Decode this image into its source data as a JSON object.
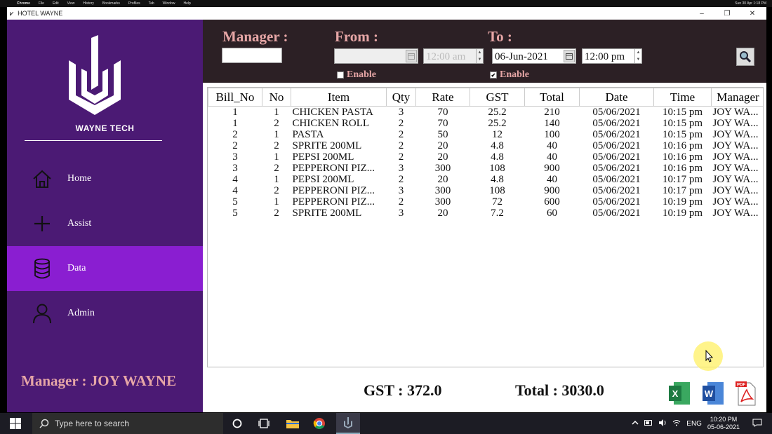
{
  "window": {
    "title": "HOTEL WAYNE"
  },
  "mac_menu": [
    "Chrome",
    "File",
    "Edit",
    "View",
    "History",
    "Bookmarks",
    "Profiles",
    "Tab",
    "Window",
    "Help"
  ],
  "mac_status": "Sun 30 Apr 1:18 PM",
  "sidebar": {
    "brand": "WAYNE TECH",
    "items": [
      {
        "label": "Home",
        "icon": "home-icon"
      },
      {
        "label": "Assist",
        "icon": "plus-icon"
      },
      {
        "label": "Data",
        "icon": "database-icon"
      },
      {
        "label": "Admin",
        "icon": "user-icon"
      }
    ],
    "active": "Data",
    "manager_label": "Manager : JOY WAYNE"
  },
  "filter": {
    "manager_label": "Manager  :",
    "manager_value": "",
    "from_label": "From :",
    "from_date": "",
    "from_time": "12:00 am",
    "from_enable_label": "Enable",
    "from_enabled": false,
    "to_label": "To :",
    "to_date": "06-Jun-2021",
    "to_time": "12:00 pm",
    "to_enable_label": "Enable",
    "to_enabled": true
  },
  "table": {
    "columns": [
      "Bill_No",
      "No",
      "Item",
      "Qty",
      "Rate",
      "GST",
      "Total",
      "Date",
      "Time",
      "Manager"
    ],
    "rows": [
      [
        "1",
        "1",
        "CHICKEN PASTA",
        "3",
        "70",
        "25.2",
        "210",
        "05/06/2021",
        "10:15 pm",
        "JOY WA..."
      ],
      [
        "1",
        "2",
        "CHICKEN ROLL",
        "2",
        "70",
        "25.2",
        "140",
        "05/06/2021",
        "10:15 pm",
        "JOY WA..."
      ],
      [
        "2",
        "1",
        "PASTA",
        "2",
        "50",
        "12",
        "100",
        "05/06/2021",
        "10:15 pm",
        "JOY WA..."
      ],
      [
        "2",
        "2",
        "SPRITE 200ML",
        "2",
        "20",
        "4.8",
        "40",
        "05/06/2021",
        "10:16 pm",
        "JOY WA..."
      ],
      [
        "3",
        "1",
        "PEPSI 200ML",
        "2",
        "20",
        "4.8",
        "40",
        "05/06/2021",
        "10:16 pm",
        "JOY WA..."
      ],
      [
        "3",
        "2",
        "PEPPERONI PIZ...",
        "3",
        "300",
        "108",
        "900",
        "05/06/2021",
        "10:16 pm",
        "JOY WA..."
      ],
      [
        "4",
        "1",
        "PEPSI 200ML",
        "2",
        "20",
        "4.8",
        "40",
        "05/06/2021",
        "10:17 pm",
        "JOY WA..."
      ],
      [
        "4",
        "2",
        "PEPPERONI PIZ...",
        "3",
        "300",
        "108",
        "900",
        "05/06/2021",
        "10:17 pm",
        "JOY WA..."
      ],
      [
        "5",
        "1",
        "PEPPERONI PIZ...",
        "2",
        "300",
        "72",
        "600",
        "05/06/2021",
        "10:19 pm",
        "JOY WA..."
      ],
      [
        "5",
        "2",
        "SPRITE 200ML",
        "3",
        "20",
        "7.2",
        "60",
        "05/06/2021",
        "10:19 pm",
        "JOY WA..."
      ]
    ]
  },
  "summary": {
    "gst": "GST : 372.0",
    "total": "Total : 3030.0"
  },
  "taskbar": {
    "search_placeholder": "Type here to search",
    "lang": "ENG",
    "time": "10:20 PM",
    "date": "05-06-2021"
  },
  "colors": {
    "sidebar": "#4b1a74",
    "active": "#8a1ed1",
    "filter_bg": "#2c2025",
    "label": "#e6a6a6"
  }
}
